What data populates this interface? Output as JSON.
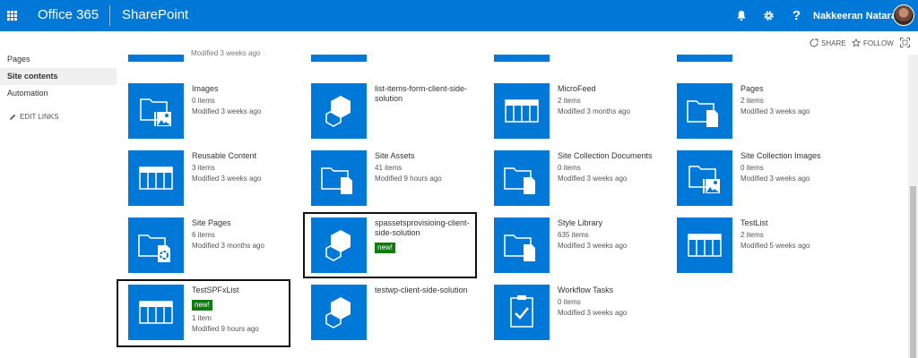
{
  "suitebar": {
    "brand": "Office 365",
    "product": "SharePoint",
    "user_name": "Nakkeeran Nataraj..."
  },
  "actions": {
    "share": "SHARE",
    "follow": "FOLLOW"
  },
  "leftnav": {
    "items": [
      "Pages",
      "Site contents",
      "Automation"
    ],
    "selected": "Site contents",
    "edit_links": "EDIT LINKS"
  },
  "partial_row": {
    "meta": "Modified 3 weeks ago"
  },
  "tiles": [
    {
      "title": "Images",
      "count": "0 items",
      "modified": "Modified 3 weeks ago",
      "icon": "picture-library-icon"
    },
    {
      "title": "list-items-form-client-side-solution",
      "count": "",
      "modified": "",
      "icon": "app-hexagon-icon"
    },
    {
      "title": "MicroFeed",
      "count": "2 items",
      "modified": "Modified 3 months ago",
      "icon": "list-icon"
    },
    {
      "title": "Pages",
      "count": "2 items",
      "modified": "Modified 3 weeks ago",
      "icon": "document-library-icon"
    },
    {
      "title": "Reusable Content",
      "count": "3 items",
      "modified": "Modified 3 weeks ago",
      "icon": "list-icon"
    },
    {
      "title": "Site Assets",
      "count": "41 items",
      "modified": "Modified 9 hours ago",
      "icon": "document-library-icon"
    },
    {
      "title": "Site Collection Documents",
      "count": "0 items",
      "modified": "Modified 3 weeks ago",
      "icon": "document-library-icon"
    },
    {
      "title": "Site Collection Images",
      "count": "0 items",
      "modified": "Modified 3 weeks ago",
      "icon": "picture-library-icon"
    },
    {
      "title": "Site Pages",
      "count": "6 items",
      "modified": "Modified 3 months ago",
      "icon": "wiki-library-icon"
    },
    {
      "title": "spassetsprovisioing-client-side-solution",
      "badge": "new!",
      "count": "",
      "modified": "",
      "icon": "app-hexagon-icon"
    },
    {
      "title": "Style Library",
      "count": "635 items",
      "modified": "Modified 3 weeks ago",
      "icon": "document-library-icon"
    },
    {
      "title": "TestList",
      "count": "2 items",
      "modified": "Modified 5 weeks ago",
      "icon": "list-icon"
    },
    {
      "title": "TestSPFxList",
      "badge": "new!",
      "count": "1 item",
      "modified": "Modified 9 hours ago",
      "icon": "list-icon"
    },
    {
      "title": "testwp-client-side-solution",
      "count": "",
      "modified": "",
      "icon": "app-hexagon-icon"
    },
    {
      "title": "Workflow Tasks",
      "count": "0 items",
      "modified": "Modified 3 weeks ago",
      "icon": "tasks-icon"
    }
  ],
  "colors": {
    "suitebar": "#0078d7",
    "tile": "#0078d7",
    "badge": "#107c10"
  }
}
